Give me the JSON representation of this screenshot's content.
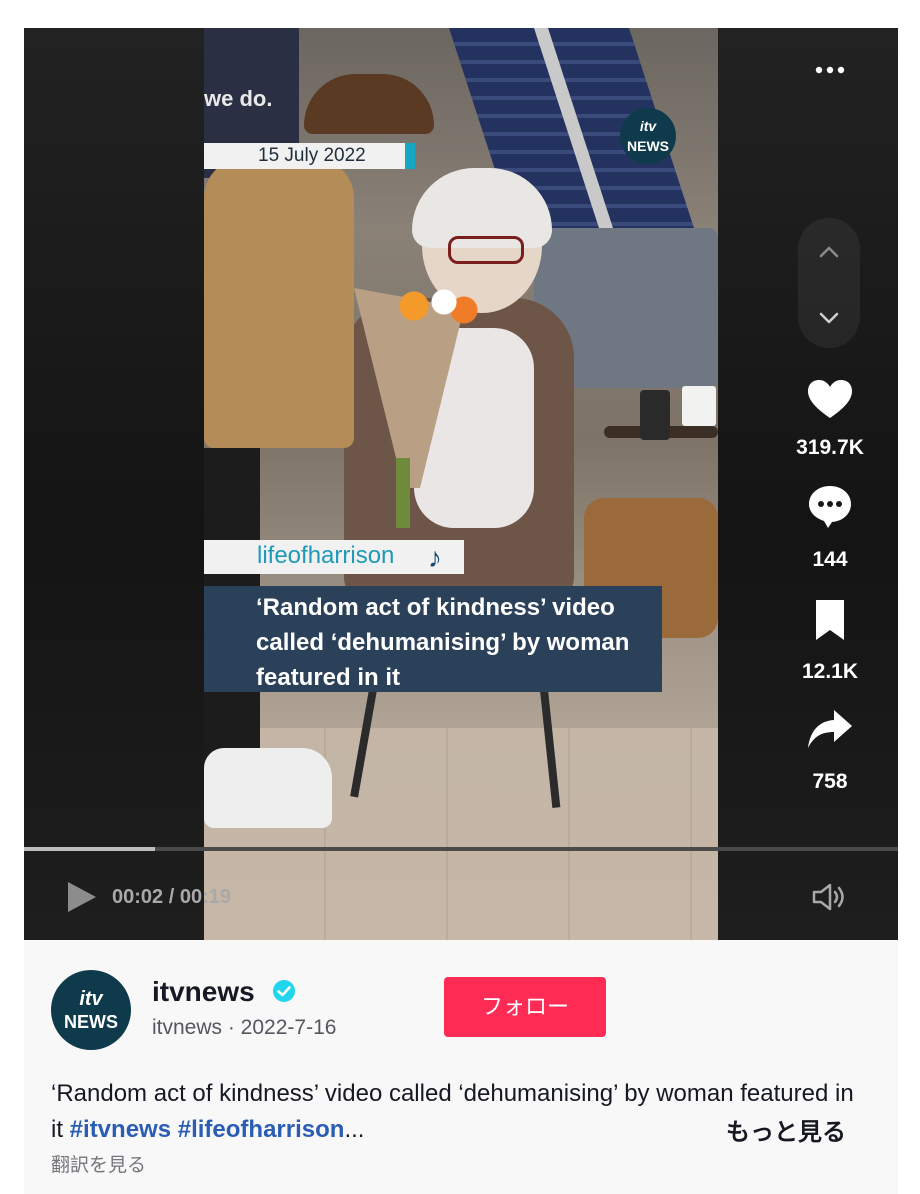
{
  "video": {
    "overlay_wall_text": "we do.",
    "date": "15 July 2022",
    "logo_top": "itv",
    "logo_bottom": "NEWS",
    "credit_handle": "lifeofharrison",
    "headline": "‘Random act of kindness’ video called ‘dehumanising’ by woman featured in it",
    "time_display": "00:02 / 00:19",
    "progress_fraction": 0.15
  },
  "actions": {
    "likes": "319.7K",
    "comments": "144",
    "saves": "12.1K",
    "shares": "758"
  },
  "author": {
    "avatar_top": "itv",
    "avatar_bottom": "NEWS",
    "name": "itvnews",
    "subline": "itvnews · 2022-7-16",
    "follow_label": "フォロー"
  },
  "description": {
    "text": "‘Random act of kindness’ video called ‘dehumanising’ by woman featured in it",
    "tag1": "#itvnews",
    "tag2": "#lifeofharrison",
    "ellipsis": "...",
    "more_label": "もっと見る",
    "translate_label": "翻訳を見る"
  },
  "colors": {
    "follow": "#fe2c55",
    "hashtag": "#2b5db4",
    "headline_bg": "#2b415a"
  }
}
